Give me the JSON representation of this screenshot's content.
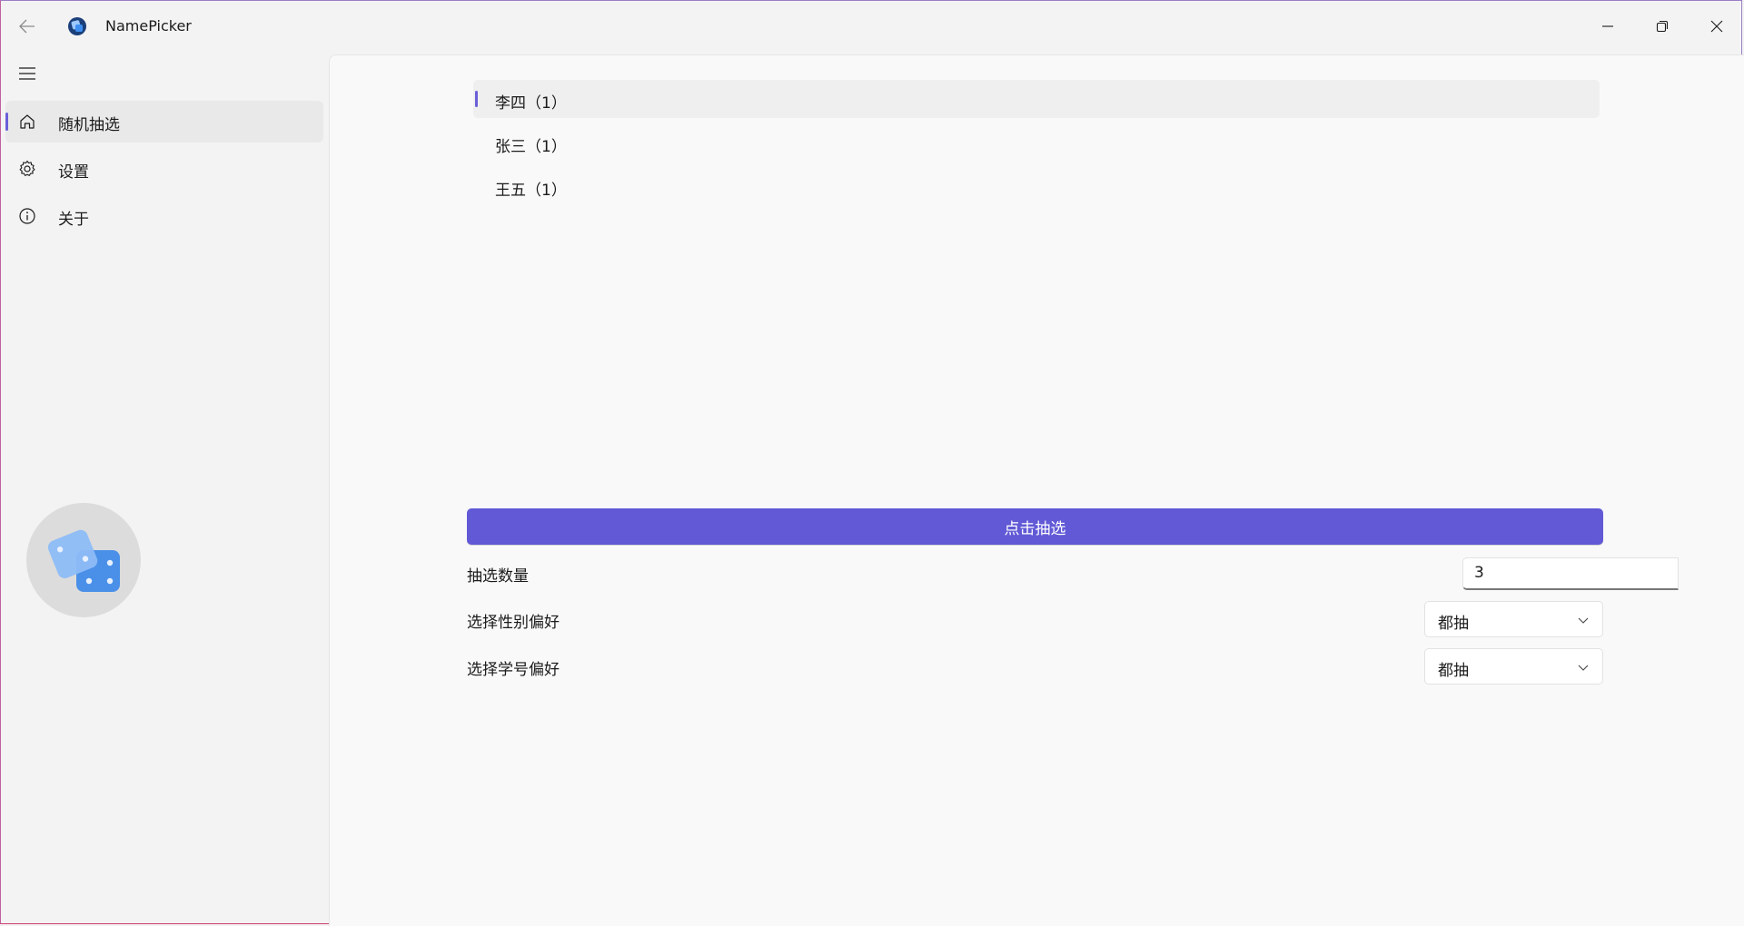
{
  "titlebar": {
    "app_title": "NamePicker",
    "back_icon": "arrow-left-icon",
    "app_icon": "app-logo-icon",
    "minimize_icon": "minimize-icon",
    "maximize_icon": "restore-icon",
    "close_icon": "close-icon"
  },
  "sidebar": {
    "menu_icon": "hamburger-icon",
    "items": [
      {
        "label": "随机抽选",
        "icon": "home-icon",
        "active": true
      },
      {
        "label": "设置",
        "icon": "gear-icon",
        "active": false
      },
      {
        "label": "关于",
        "icon": "info-icon",
        "active": false
      }
    ],
    "avatar_icon": "dice-icon"
  },
  "main": {
    "results": [
      {
        "text": "李四（1）",
        "selected": true
      },
      {
        "text": "张三（1）",
        "selected": false
      },
      {
        "text": "王五（1）",
        "selected": false
      }
    ],
    "pick_button_label": "点击抽选",
    "count": {
      "label": "抽选数量",
      "value": "3"
    },
    "gender_pref": {
      "label": "选择性别偏好",
      "value": "都抽"
    },
    "id_pref": {
      "label": "选择学号偏好",
      "value": "都抽"
    }
  },
  "colors": {
    "accent": "#6159d6",
    "indicator": "#6b5fd8",
    "dice_light": "#7fb3f5",
    "dice_dark": "#4a90e8"
  }
}
